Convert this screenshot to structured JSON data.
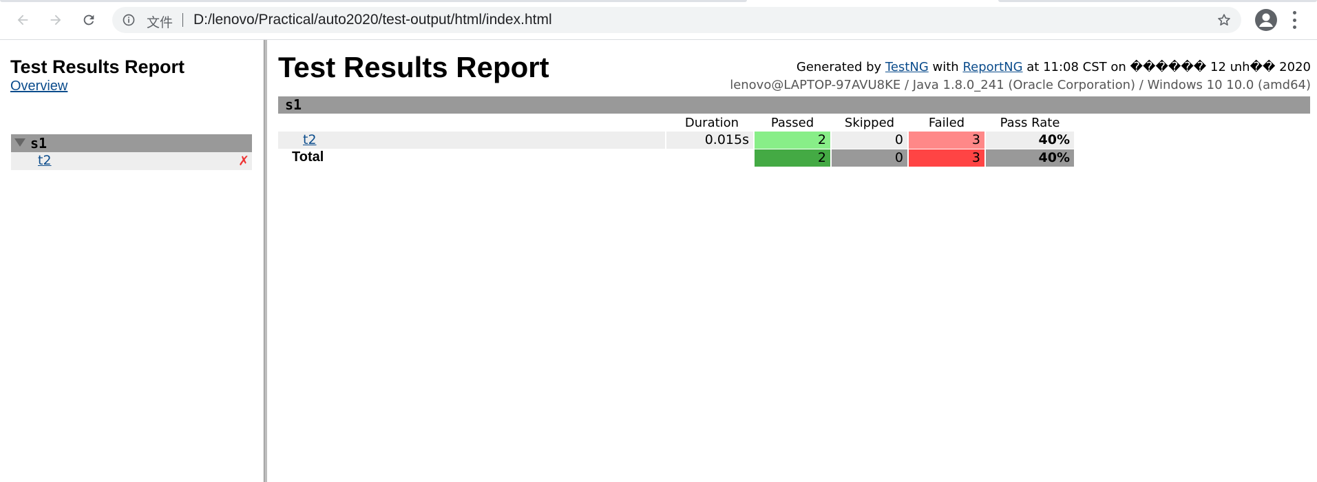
{
  "browser": {
    "scheme_label": "文件",
    "url": "D:/lenovo/Practical/auto2020/test-output/html/index.html"
  },
  "sidebar": {
    "title": "Test Results Report",
    "overview_link": "Overview",
    "suite": {
      "name": "s1",
      "tests": [
        {
          "name": "t2",
          "status_glyph": "✗"
        }
      ]
    }
  },
  "main": {
    "title": "Test Results Report",
    "generated": {
      "prefix": "Generated by",
      "testng": "TestNG",
      "with": "with",
      "reportng": "ReportNG",
      "suffix": "at 11:08 CST on ������ 12 տհ�� 2020"
    },
    "sysinfo": "lenovo@LAPTOP-97AVU8KE / Java 1.8.0_241 (Oracle Corporation) / Windows 10 10.0 (amd64)",
    "suite_name": "s1",
    "columns": {
      "duration": "Duration",
      "passed": "Passed",
      "skipped": "Skipped",
      "failed": "Failed",
      "pass_rate": "Pass Rate"
    },
    "rows": [
      {
        "name": "t2",
        "duration": "0.015s",
        "passed": "2",
        "skipped": "0",
        "failed": "3",
        "pass_rate": "40%"
      }
    ],
    "total": {
      "label": "Total",
      "passed": "2",
      "skipped": "0",
      "failed": "3",
      "pass_rate": "40%"
    }
  },
  "colors": {
    "passed_light": "#88ee88",
    "passed_dark": "#44aa44",
    "failed_light": "#ff8888",
    "failed_dark": "#ff4444",
    "neutral": "#eeeeee",
    "neutral_dark": "#999999",
    "link": "#0b4c8c"
  }
}
